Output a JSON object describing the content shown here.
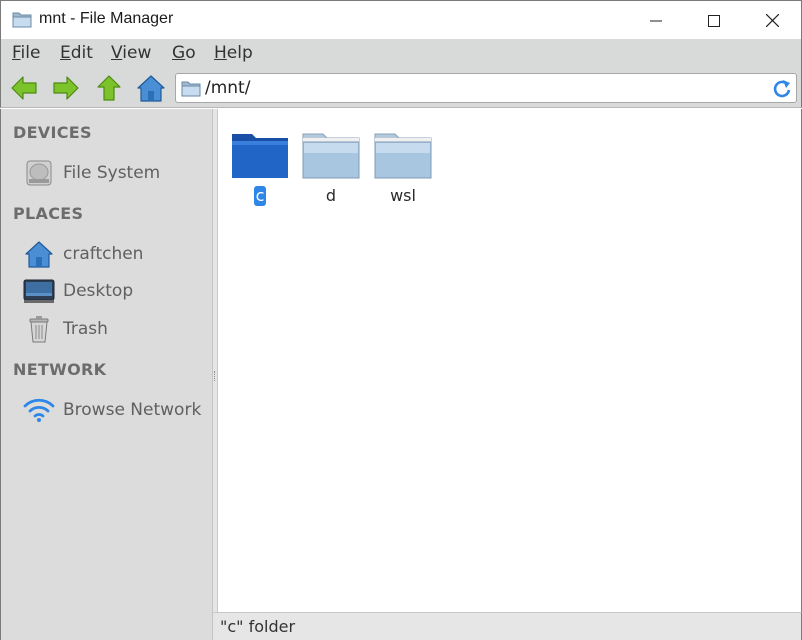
{
  "window": {
    "title": "mnt - File Manager"
  },
  "menu": [
    {
      "mnemonic": "F",
      "rest": "ile"
    },
    {
      "mnemonic": "E",
      "rest": "dit"
    },
    {
      "mnemonic": "V",
      "rest": "iew"
    },
    {
      "mnemonic": "G",
      "rest": "o"
    },
    {
      "mnemonic": "H",
      "rest": "elp"
    }
  ],
  "toolbar": {
    "buttons": [
      "back-icon",
      "forward-icon",
      "up-icon",
      "home-icon"
    ],
    "path": "/mnt/"
  },
  "sidebar": {
    "sections": [
      {
        "heading": "DEVICES",
        "items": [
          {
            "label": "File System",
            "icon": "drive-icon"
          }
        ]
      },
      {
        "heading": "PLACES",
        "items": [
          {
            "label": "craftchen",
            "icon": "home-icon"
          },
          {
            "label": "Desktop",
            "icon": "desktop-icon"
          },
          {
            "label": "Trash",
            "icon": "trash-icon"
          }
        ]
      },
      {
        "heading": "NETWORK",
        "items": [
          {
            "label": "Browse Network",
            "icon": "network-icon"
          }
        ]
      }
    ]
  },
  "content": {
    "folders": [
      {
        "name": "c",
        "selected": true
      },
      {
        "name": "d",
        "selected": false
      },
      {
        "name": "wsl",
        "selected": false
      }
    ]
  },
  "status": {
    "text": "\"c\" folder"
  },
  "colors": {
    "selection": "#2e87e6",
    "sidebar_bg": "#dcdcdc",
    "toolbar_bg": "#d8d9d9",
    "nav_arrow_green": "#7cc22a"
  }
}
